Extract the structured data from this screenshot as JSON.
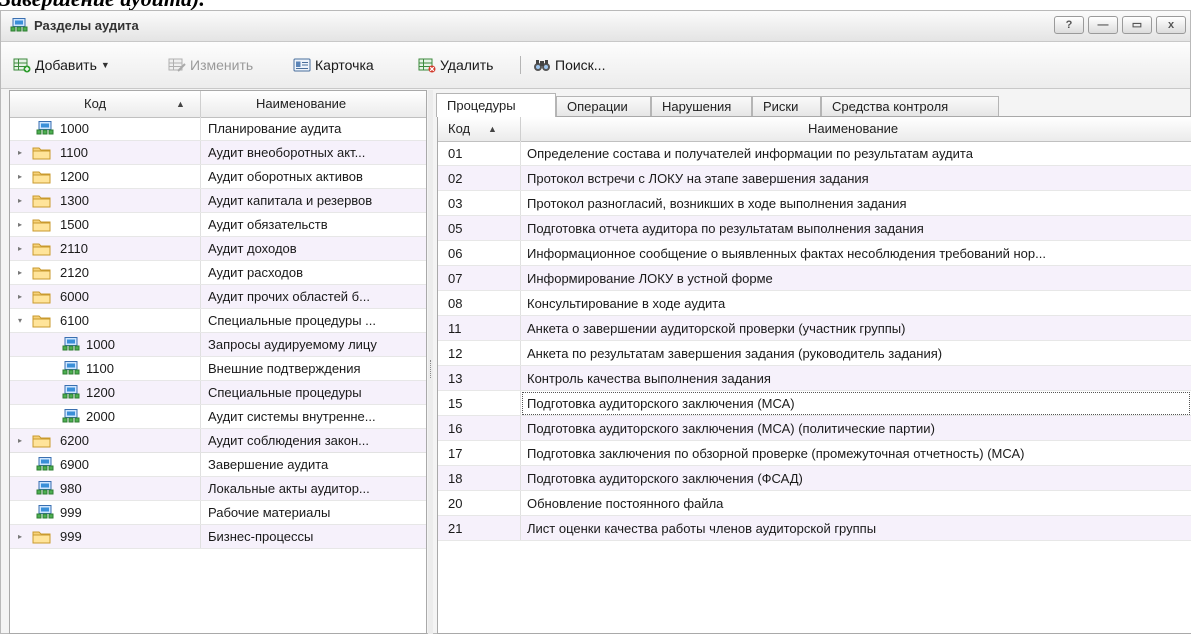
{
  "doc_caption": "Завершение аудита).",
  "window": {
    "title": "Разделы аудита",
    "buttons": {
      "help": "?",
      "minimize": "—",
      "maximize": "▭",
      "close": "x"
    }
  },
  "toolbar": {
    "add_label": "Добавить",
    "edit_label": "Изменить",
    "card_label": "Карточка",
    "delete_label": "Удалить",
    "search_label": "Поиск..."
  },
  "tree": {
    "headers": {
      "code": "Код",
      "name": "Наименование"
    },
    "rows": [
      {
        "code": "1000",
        "name": "Планирование аудита",
        "type": "item",
        "level": 0,
        "expander": ""
      },
      {
        "code": "1100",
        "name": "Аудит внеоборотных акт...",
        "type": "folder",
        "level": 0,
        "expander": "▸"
      },
      {
        "code": "1200",
        "name": "Аудит оборотных активов",
        "type": "folder",
        "level": 0,
        "expander": "▸"
      },
      {
        "code": "1300",
        "name": "Аудит капитала и резервов",
        "type": "folder",
        "level": 0,
        "expander": "▸"
      },
      {
        "code": "1500",
        "name": "Аудит обязательств",
        "type": "folder",
        "level": 0,
        "expander": "▸"
      },
      {
        "code": "2110",
        "name": "Аудит доходов",
        "type": "folder",
        "level": 0,
        "expander": "▸"
      },
      {
        "code": "2120",
        "name": "Аудит расходов",
        "type": "folder",
        "level": 0,
        "expander": "▸"
      },
      {
        "code": "6000",
        "name": "Аудит прочих областей б...",
        "type": "folder",
        "level": 0,
        "expander": "▸"
      },
      {
        "code": "6100",
        "name": "Специальные процедуры ...",
        "type": "folder",
        "level": 0,
        "expander": "▾"
      },
      {
        "code": "1000",
        "name": "Запросы аудируемому лицу",
        "type": "item",
        "level": 1,
        "expander": ""
      },
      {
        "code": "1100",
        "name": "Внешние подтверждения",
        "type": "item",
        "level": 1,
        "expander": ""
      },
      {
        "code": "1200",
        "name": "Специальные процедуры",
        "type": "item",
        "level": 1,
        "expander": ""
      },
      {
        "code": "2000",
        "name": "Аудит системы внутренне...",
        "type": "item",
        "level": 1,
        "expander": ""
      },
      {
        "code": "6200",
        "name": "Аудит соблюдения закон...",
        "type": "folder",
        "level": 0,
        "expander": "▸"
      },
      {
        "code": "6900",
        "name": "Завершение аудита",
        "type": "item",
        "level": 0,
        "expander": "",
        "selected": true
      },
      {
        "code": "980",
        "name": "Локальные акты аудитор...",
        "type": "item",
        "level": 0,
        "expander": ""
      },
      {
        "code": "999",
        "name": "Рабочие материалы",
        "type": "item",
        "level": 0,
        "expander": ""
      },
      {
        "code": "999",
        "name": "Бизнес-процессы",
        "type": "folder",
        "level": 0,
        "expander": "▸"
      }
    ]
  },
  "tabs": [
    "Процедуры",
    "Операции",
    "Нарушения",
    "Риски",
    "Средства контроля"
  ],
  "active_tab": 0,
  "procedures": {
    "headers": {
      "code": "Код",
      "name": "Наименование"
    },
    "rows": [
      {
        "code": "01",
        "name": "Определение состава и получателей информации по результатам аудита"
      },
      {
        "code": "02",
        "name": "Протокол встречи с ЛОКУ на этапе завершения задания"
      },
      {
        "code": "03",
        "name": "Протокол разногласий, возникших в ходе выполнения задания"
      },
      {
        "code": "05",
        "name": "Подготовка отчета аудитора по результатам выполнения задания"
      },
      {
        "code": "06",
        "name": "Информационное сообщение о выявленных фактах несоблюдения требований нор..."
      },
      {
        "code": "07",
        "name": "Информирование ЛОКУ в устной форме"
      },
      {
        "code": "08",
        "name": "Консультирование в ходе аудита"
      },
      {
        "code": "11",
        "name": "Анкета о завершении аудиторской проверки (участник группы)"
      },
      {
        "code": "12",
        "name": "Анкета по результатам завершения задания (руководитель задания)"
      },
      {
        "code": "13",
        "name": "Контроль качества выполнения задания"
      },
      {
        "code": "15",
        "name": "Подготовка аудиторского заключения (МСА)",
        "focused": true
      },
      {
        "code": "16",
        "name": "Подготовка аудиторского заключения (МСА) (политические партии)"
      },
      {
        "code": "17",
        "name": "Подготовка заключения по обзорной проверке (промежуточная отчетность) (МСА)"
      },
      {
        "code": "18",
        "name": "Подготовка аудиторского заключения (ФСАД)"
      },
      {
        "code": "20",
        "name": "Обновление постоянного файла"
      },
      {
        "code": "21",
        "name": "Лист оценки качества работы членов аудиторской группы"
      }
    ]
  }
}
